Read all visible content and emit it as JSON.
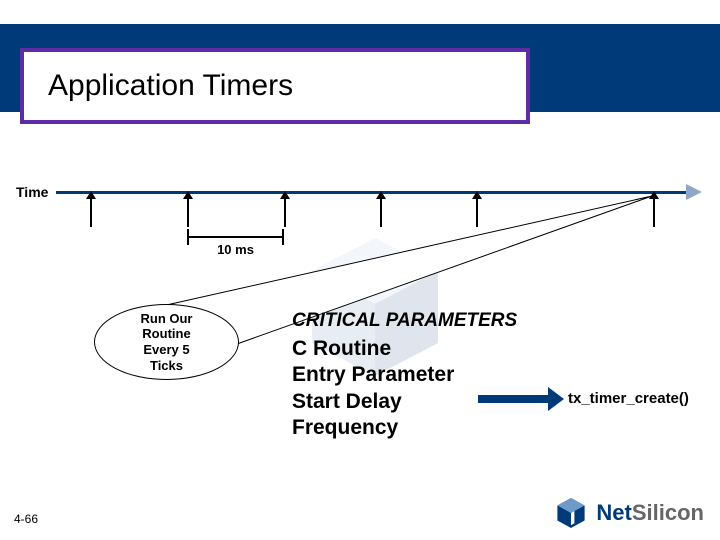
{
  "title": "Application Timers",
  "timeline": {
    "axis_label": "Time",
    "interval_label": "10 ms",
    "tick_count": 6
  },
  "routine_bubble": "Run Our\nRoutine\nEvery 5\nTicks",
  "params": {
    "heading": "CRITICAL PARAMETERS",
    "items": [
      "C Routine",
      "Entry Parameter",
      "Start Delay",
      "Frequency"
    ]
  },
  "function_name": "tx_timer_create()",
  "page_number": "4-66",
  "brand": {
    "net": "Net",
    "silicon": "Silicon"
  }
}
